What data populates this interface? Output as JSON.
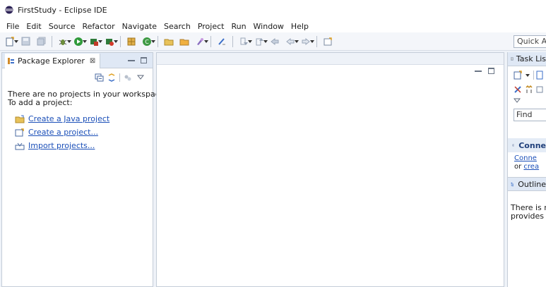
{
  "window": {
    "title": "FirstStudy - Eclipse IDE"
  },
  "menu": [
    "File",
    "Edit",
    "Source",
    "Refactor",
    "Navigate",
    "Search",
    "Project",
    "Run",
    "Window",
    "Help"
  ],
  "toolbar": {
    "quick_access": "Quick Ac"
  },
  "package_explorer": {
    "tab_label": "Package Explorer",
    "close_glyph": "⊠",
    "message_line1": "There are no projects in your workspace.",
    "message_line2": "To add a project:",
    "links": [
      "Create a Java project",
      "Create a project...",
      "Import projects..."
    ]
  },
  "task_list": {
    "tab_label": "Task Lis",
    "find_placeholder": "Find",
    "connect_title": "Conne",
    "connect_line1": "Conne",
    "connect_line2_prefix": "or ",
    "connect_line2_link": "crea"
  },
  "outline": {
    "tab_label": "Outline",
    "message_line1": "There is no",
    "message_line2": "provides an"
  },
  "colors": {
    "link": "#1b4fb8",
    "panel_header": "#dfe8f5",
    "accent_blue": "#1f3f7a"
  }
}
